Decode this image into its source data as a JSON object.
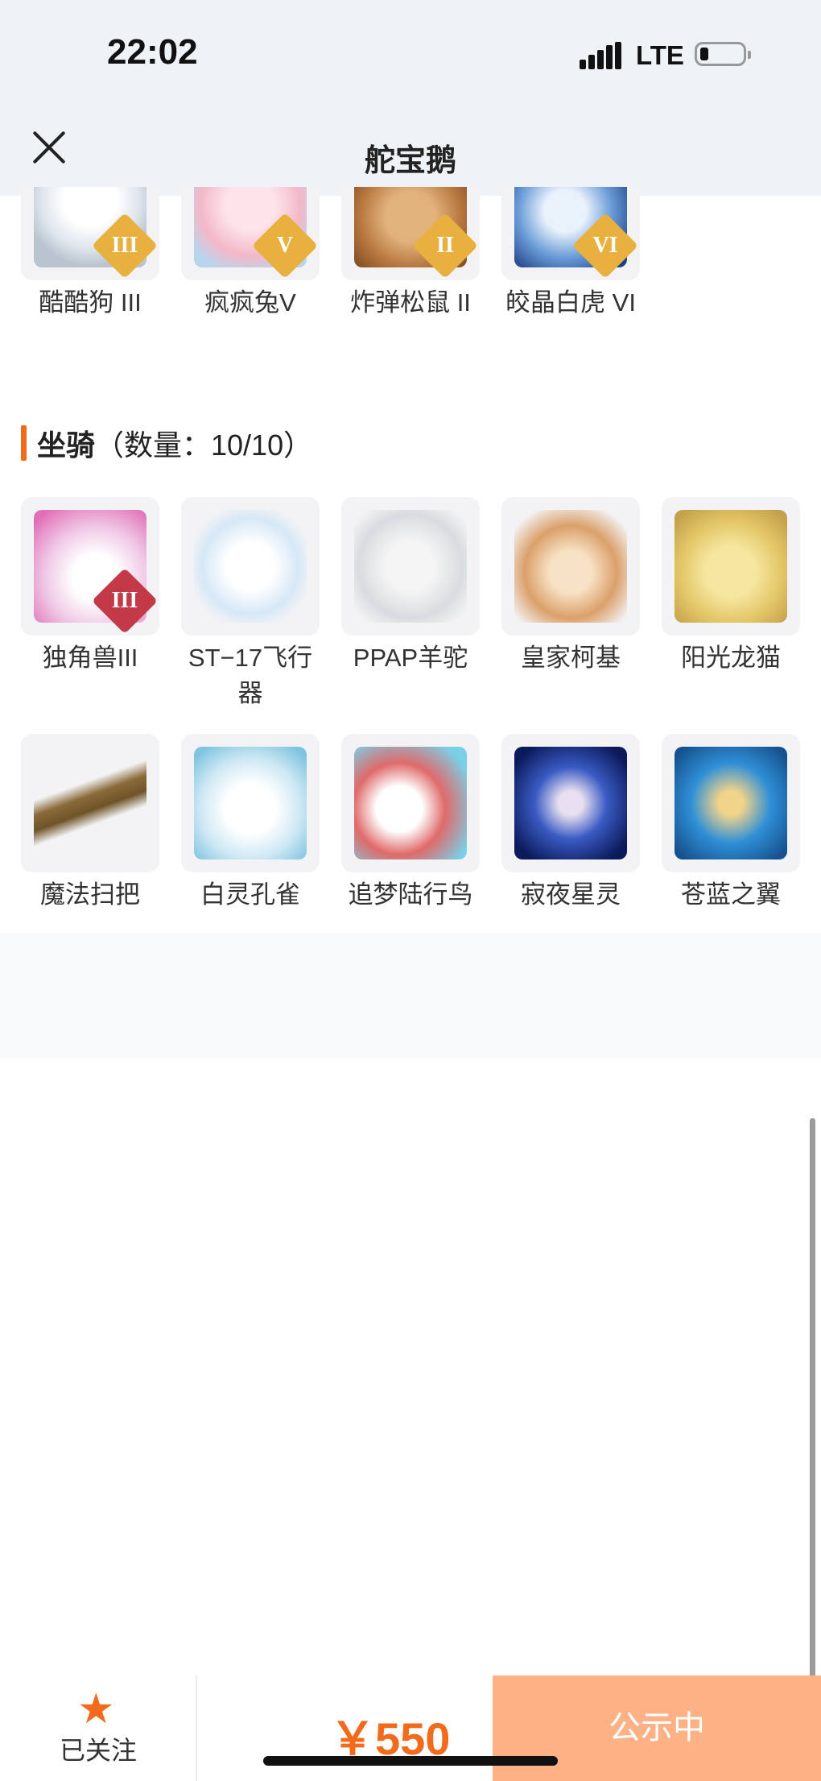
{
  "status_bar": {
    "time": "22:02",
    "network": "LTE"
  },
  "nav": {
    "title": "舵宝鹅"
  },
  "pets_row": [
    {
      "label": "酷酷狗 III",
      "badge": "III",
      "icon": "white-dog-goggles"
    },
    {
      "label": "疯疯兔V",
      "badge": "V",
      "icon": "pink-rabbit"
    },
    {
      "label": "炸弹松鼠 II",
      "badge": "II",
      "icon": "squirrel-hat"
    },
    {
      "label": "皎晶白虎 VI",
      "badge": "VI",
      "icon": "white-tiger"
    }
  ],
  "mounts_section": {
    "title": "坐骑",
    "count_text": "（数量：10/10）"
  },
  "mounts": [
    {
      "label": "独角兽III",
      "badge": "III",
      "icon": "unicorn"
    },
    {
      "label": "ST−17飞行器",
      "icon": "aircraft"
    },
    {
      "label": "PPAP羊驼",
      "icon": "alpaca-sunglasses"
    },
    {
      "label": "皇家柯基",
      "icon": "corgi-crown"
    },
    {
      "label": "阳光龙猫",
      "icon": "totoro-cat"
    },
    {
      "label": "魔法扫把",
      "icon": "magic-broom"
    },
    {
      "label": "白灵孔雀",
      "icon": "white-peacock"
    },
    {
      "label": "追梦陆行鸟",
      "icon": "dream-bird"
    },
    {
      "label": "寂夜星灵",
      "icon": "night-star-wolf"
    },
    {
      "label": "苍蓝之翼",
      "icon": "blue-dragon"
    }
  ],
  "bottom_bar": {
    "follow_label": "已关注",
    "price": "￥550",
    "status_button": "公示中"
  },
  "colors": {
    "accent": "#f26b1d",
    "button_bg": "#fdb185"
  }
}
